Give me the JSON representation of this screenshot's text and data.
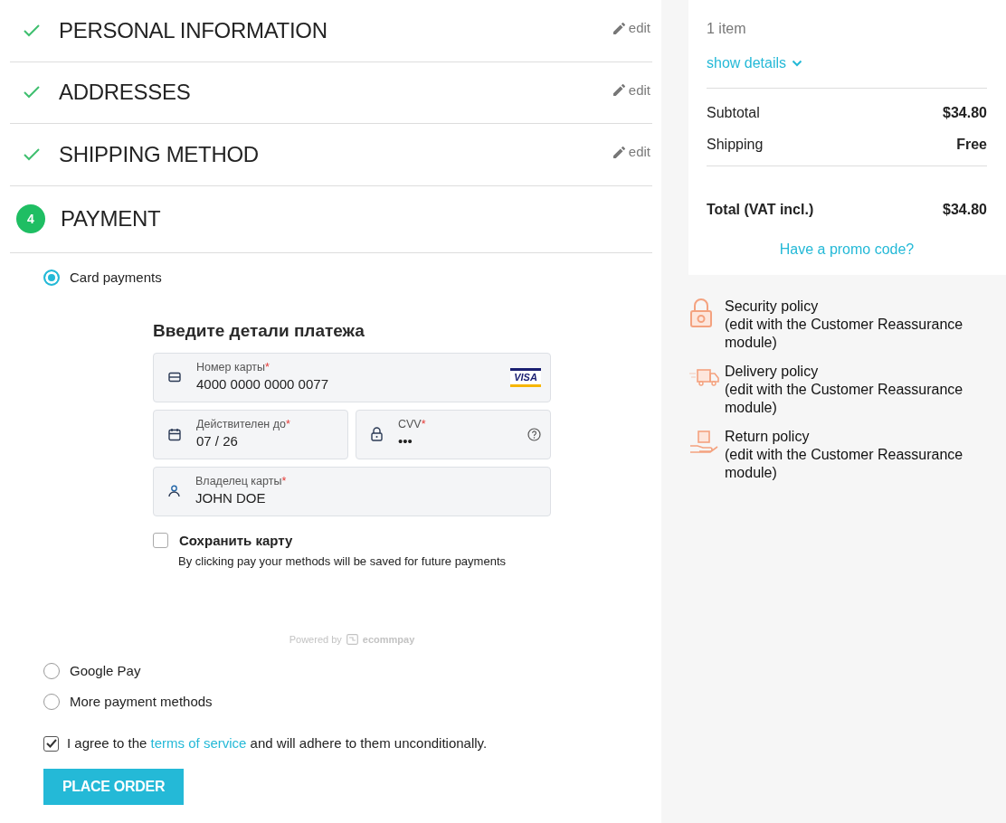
{
  "steps": [
    {
      "title": "PERSONAL INFORMATION",
      "kind": "done",
      "edit": "edit"
    },
    {
      "title": "ADDRESSES",
      "kind": "done",
      "edit": "edit"
    },
    {
      "title": "SHIPPING METHOD",
      "kind": "done",
      "edit": "edit"
    },
    {
      "number": "4",
      "title": "PAYMENT",
      "kind": "current"
    }
  ],
  "payment_methods": [
    {
      "label": "Card payments",
      "selected": true
    },
    {
      "label": "Google Pay",
      "selected": false
    },
    {
      "label": "More payment methods",
      "selected": false
    }
  ],
  "card_form": {
    "heading": "Введите детали платежа",
    "fields": [
      {
        "kind": "card",
        "label": "Номер карты",
        "required_mark": "*",
        "value": "4000 0000 0000 0077",
        "brand": "VISA"
      },
      {
        "kind": "date",
        "label": "Действителен до",
        "required_mark": "*",
        "value": "07 / 26"
      },
      {
        "kind": "cvv",
        "label": "CVV",
        "required_mark": "*",
        "value": "•••"
      },
      {
        "kind": "person",
        "label": "Владелец карты",
        "required_mark": "*",
        "value": "JOHN DOE"
      }
    ],
    "save_card": {
      "label": "Сохранить карту",
      "checked": false,
      "note": "By clicking pay your methods will be saved for future payments"
    },
    "powered_by": "Powered by",
    "provider": "ecommpay"
  },
  "terms": {
    "checked": true,
    "before": "I agree to the",
    "link": "terms of service",
    "after": "and will adhere to them unconditionally."
  },
  "place_order": "PLACE ORDER",
  "summary": {
    "items": "1 item",
    "show_details": "show details",
    "lines": [
      {
        "label": "Subtotal",
        "value": "$34.80"
      },
      {
        "label": "Shipping",
        "value": "Free"
      }
    ],
    "total": {
      "label": "Total (VAT incl.)",
      "value": "$34.80"
    },
    "promo": "Have a promo code?"
  },
  "reassurance": [
    {
      "kind": "security",
      "title": "Security policy",
      "note": "(edit with the Customer Reassurance module)"
    },
    {
      "kind": "delivery",
      "title": "Delivery policy",
      "note": "(edit with the Customer Reassurance module)"
    },
    {
      "kind": "return",
      "title": "Return policy",
      "note": "(edit with the Customer Reassurance module)"
    }
  ]
}
